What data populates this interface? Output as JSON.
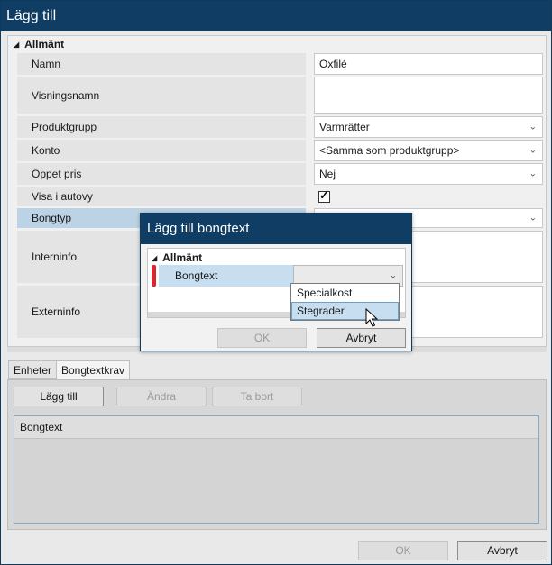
{
  "window": {
    "title": "Lägg till"
  },
  "propgrid": {
    "section": "Allmänt",
    "rows": [
      {
        "label": "Namn",
        "value": "Oxfilé"
      },
      {
        "label": "Visningsnamn",
        "value": ""
      },
      {
        "label": "Produktgrupp",
        "value": "Varmrätter"
      },
      {
        "label": "Konto",
        "value": "<Samma som produktgrupp>"
      },
      {
        "label": "Öppet pris",
        "value": "Nej"
      },
      {
        "label": "Visa i autovy",
        "checked": true
      },
      {
        "label": "Bongtyp",
        "value": ""
      },
      {
        "label": "Interninfo",
        "value": ""
      },
      {
        "label": "Externinfo",
        "value": ""
      }
    ]
  },
  "tabs": [
    {
      "label": "Enheter"
    },
    {
      "label": "Bongtextkrav"
    }
  ],
  "toolbar": {
    "add_label": "Lägg till",
    "edit_label": "Ändra",
    "remove_label": "Ta bort"
  },
  "list": {
    "header": "Bongtext"
  },
  "footer": {
    "ok_label": "OK",
    "cancel_label": "Avbryt"
  },
  "dialog": {
    "title": "Lägg till bongtext",
    "section": "Allmänt",
    "field_label": "Bongtext",
    "field_value": "",
    "options": [
      "Specialkost",
      "Stegrader"
    ],
    "ok_label": "OK",
    "cancel_label": "Avbryt"
  },
  "colors": {
    "titlebar": "#0f3d63",
    "selected_row": "#bcd3e6",
    "required_marker": "#d7282f"
  }
}
